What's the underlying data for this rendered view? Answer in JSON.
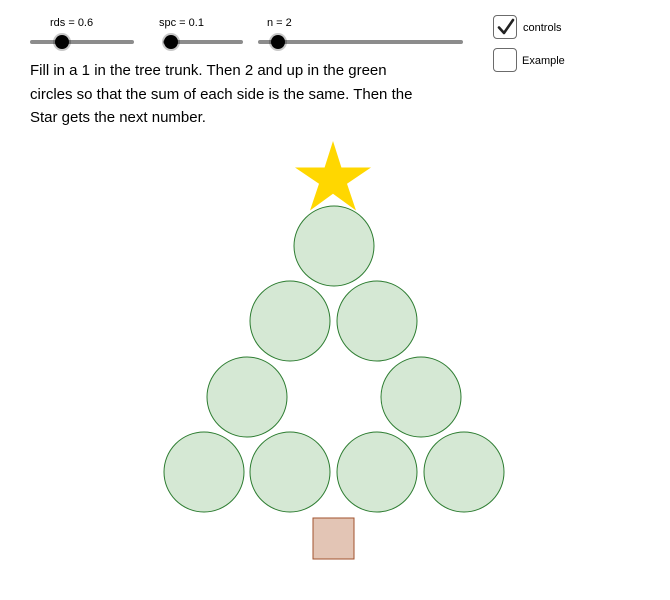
{
  "sliders": [
    {
      "id": "rds",
      "label": "rds = 0.6",
      "value": 0.6
    },
    {
      "id": "spc",
      "label": "spc = 0.1",
      "value": 0.1
    },
    {
      "id": "n",
      "label": "n = 2",
      "value": 2
    }
  ],
  "checkboxes": [
    {
      "id": "controls",
      "label": "controls",
      "checked": true
    },
    {
      "id": "example",
      "label": "Example",
      "checked": false
    }
  ],
  "instructions": "Fill in a 1 in the tree trunk. Then 2 and up in the green circles so that the sum of each side is the same. Then the Star gets the next number.",
  "colors": {
    "circle_fill": "#d5e8d4",
    "circle_stroke": "#2e7d32",
    "star_fill": "#ffd700",
    "trunk_fill": "#e3c5b5",
    "trunk_stroke": "#a0522d",
    "slider_track": "#8c8c8c",
    "slider_knob": "#000000"
  },
  "icons": {
    "star": "star-icon",
    "checkmark": "checkmark-icon"
  }
}
